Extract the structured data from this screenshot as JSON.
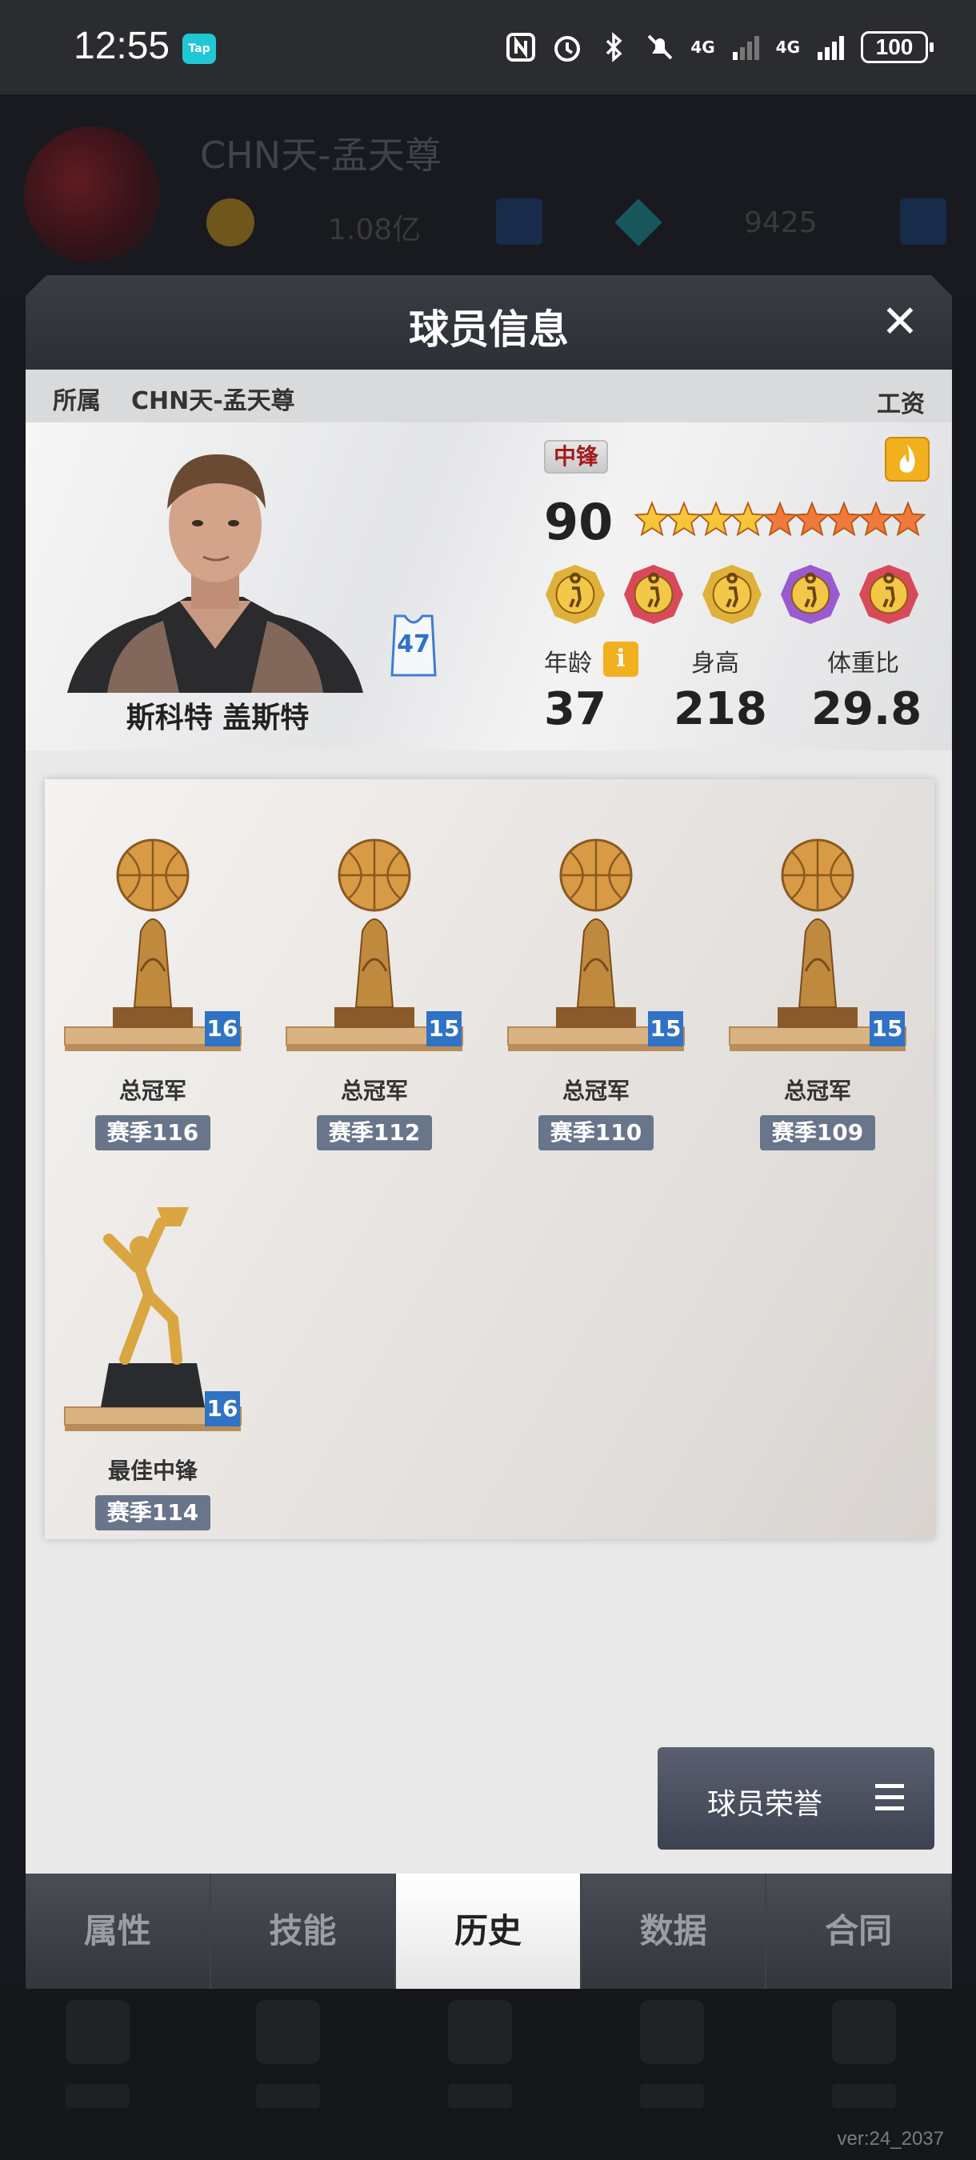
{
  "status_bar": {
    "time": "12:55",
    "tap_badge": "Tap",
    "network1": "4G",
    "network2": "4G",
    "battery": "100"
  },
  "background": {
    "team_name": "CHN天-孟天尊",
    "coins": "1.08亿",
    "gems": "9425"
  },
  "modal": {
    "title": "球员信息",
    "close_icon": "close-icon",
    "owner_label": "所属",
    "owner_team": "CHN天-孟天尊",
    "salary_label": "工资",
    "player": {
      "name": "斯科特 盖斯特",
      "jersey_number": "47",
      "position": "中锋",
      "overall": "90",
      "stars_total": 9,
      "stars_gold": 4,
      "skill_icons": [
        "skill-post-icon",
        "skill-rebound-icon",
        "skill-speed-icon",
        "skill-strength-icon",
        "skill-shoot-icon"
      ],
      "age_label": "年龄",
      "age": "37",
      "height_label": "身高",
      "height": "218",
      "weight_label": "体重比",
      "weight": "29.8",
      "info_icon": "i"
    },
    "honors": [
      {
        "title": "总冠军",
        "season": "赛季116",
        "count": "16",
        "type": "championship"
      },
      {
        "title": "总冠军",
        "season": "赛季112",
        "count": "15",
        "type": "championship"
      },
      {
        "title": "总冠军",
        "season": "赛季110",
        "count": "15",
        "type": "championship"
      },
      {
        "title": "总冠军",
        "season": "赛季109",
        "count": "15",
        "type": "championship"
      },
      {
        "title": "最佳中锋",
        "season": "赛季114",
        "count": "16",
        "type": "best-center"
      }
    ],
    "honors_button": "球员荣誉",
    "tabs": [
      "属性",
      "技能",
      "历史",
      "数据",
      "合同"
    ],
    "active_tab": "历史"
  },
  "version": "ver:24_2037",
  "colors": {
    "accent_gold": "#f2b01e",
    "badge_blue": "#2f72c6",
    "season_tag": "#68758a",
    "position_red": "#a31d1d"
  }
}
